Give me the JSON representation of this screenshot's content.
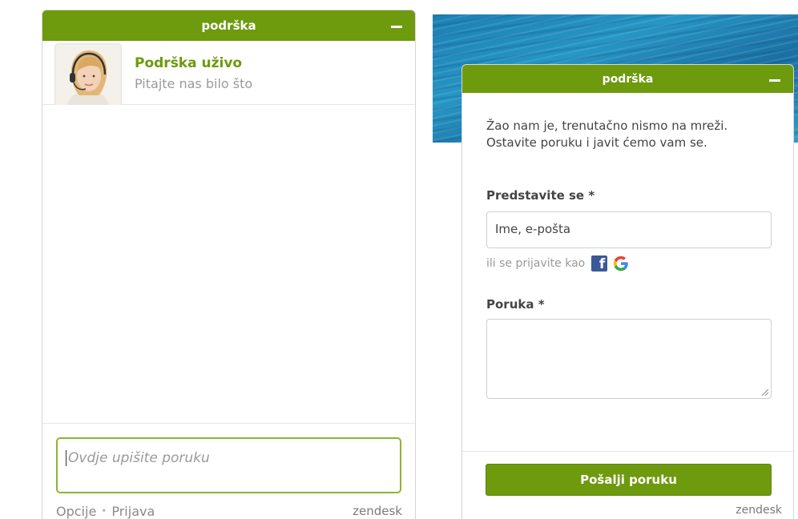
{
  "left_widget": {
    "title": "podrška",
    "agent": {
      "name": "Podrška uživo",
      "subtitle": "Pitajte nas bilo što"
    },
    "input_placeholder": "Ovdje upišite poruku",
    "footer": {
      "options": "Opcije",
      "separator": "•",
      "login": "Prijava",
      "brand": "zendesk"
    }
  },
  "right_widget": {
    "title": "podrška",
    "offline_message": "Žao nam je, trenutačno nismo na mreži. Ostavite poruku i javit ćemo vam se.",
    "name_label": "Predstavite se *",
    "name_placeholder": "Ime, e-pošta",
    "social_text": "ili se prijavite kao",
    "facebook_glyph": "f",
    "message_label": "Poruka *",
    "send_label": "Pošalji poruku",
    "brand": "zendesk"
  },
  "colors": {
    "accent": "#6e9a0e",
    "accent_text": "#6b9a0c",
    "input_focus": "#8bb632",
    "facebook": "#3b5998"
  }
}
